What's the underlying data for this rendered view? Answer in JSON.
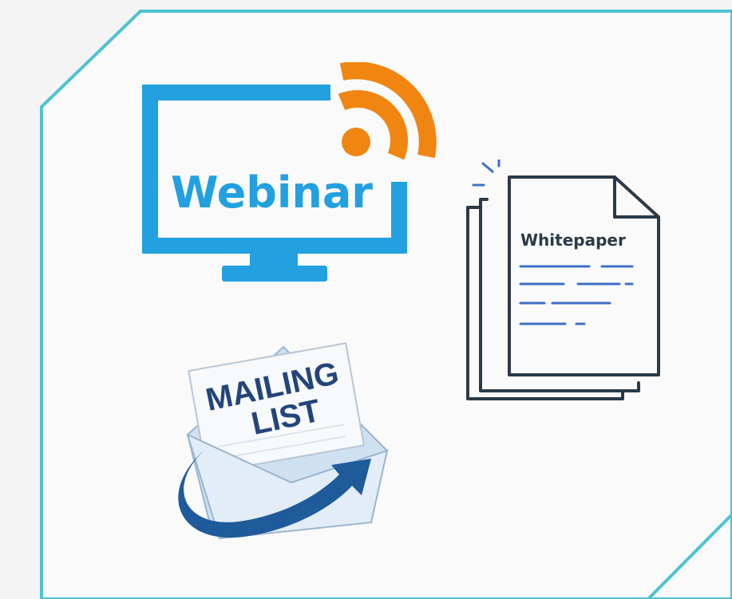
{
  "webinar": {
    "label": "Webinar"
  },
  "whitepaper": {
    "label": "Whitepaper"
  },
  "mailing_list": {
    "line1": "MAILING",
    "line2": "LIST"
  },
  "colors": {
    "background": "#f4f4f4",
    "panel_fill": "#f9f9f9",
    "panel_border": "#4dc3d1",
    "webinar_blue": "#22a0e0",
    "rss_orange": "#f08511",
    "whitepaper_ink": "#2b3a48",
    "whitepaper_lines": "#3d6fc5",
    "mailing_navy": "#23457a",
    "arrow_blue": "#1f5b9a"
  }
}
